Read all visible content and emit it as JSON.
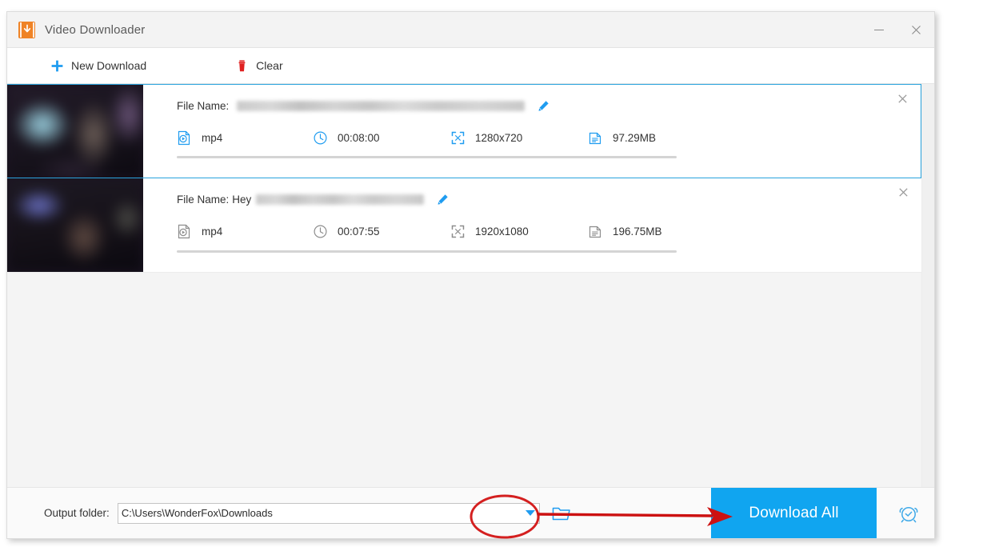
{
  "window": {
    "title": "Video Downloader",
    "app_icon": "video-download-icon",
    "controls": {
      "minimize": "–",
      "close": "×"
    }
  },
  "toolbar": {
    "items": [
      {
        "label": "New Download",
        "icon": "plus-icon",
        "color": "#1f9cf0"
      },
      {
        "label": "Clear",
        "icon": "trash-icon",
        "color": "#e02020"
      }
    ]
  },
  "list": {
    "filename_label": "File Name:",
    "items": [
      {
        "selected": true,
        "thumbnail": "video-thumbnail-blurred",
        "filename_visible": "",
        "filename_redacted": true,
        "redacted_width": 360,
        "edit_icon": "pencil-icon",
        "close_icon": "close-icon",
        "format": "mp4",
        "duration": "00:08:00",
        "resolution": "1280x720",
        "filesize": "97.29MB",
        "progress_percent": 0,
        "icon_color": "#1f9cf0"
      },
      {
        "selected": false,
        "thumbnail": "video-thumbnail-blurred",
        "filename_visible": "Hey",
        "filename_redacted": true,
        "redacted_width": 210,
        "edit_icon": "pencil-icon",
        "close_icon": "close-icon",
        "format": "mp4",
        "duration": "00:07:55",
        "resolution": "1920x1080",
        "filesize": "196.75MB",
        "progress_percent": 0,
        "icon_color": "#8d8d8d"
      }
    ]
  },
  "bottom": {
    "output_label": "Output folder:",
    "output_path": "C:\\Users\\WonderFox\\Downloads",
    "output_placeholder": "C:\\Users\\WonderFox\\Downloads",
    "dropdown_icon": "chevron-down-icon",
    "browse_icon": "folder-icon",
    "download_all_label": "Download All",
    "alarm_icon": "alarm-clock-icon"
  },
  "annotation": {
    "ellipse_color": "#d42020",
    "arrow_color": "#cc1111",
    "ellipse_target": "output-folder-dropdown",
    "arrow_target": "download-all-button"
  },
  "colors": {
    "accent_blue": "#1f9cf0",
    "button_blue": "#10a5f0",
    "selected_border": "#29a3dd",
    "app_icon_orange": "#ef8326",
    "trash_red": "#e02020",
    "annotation_red": "#d42020"
  }
}
